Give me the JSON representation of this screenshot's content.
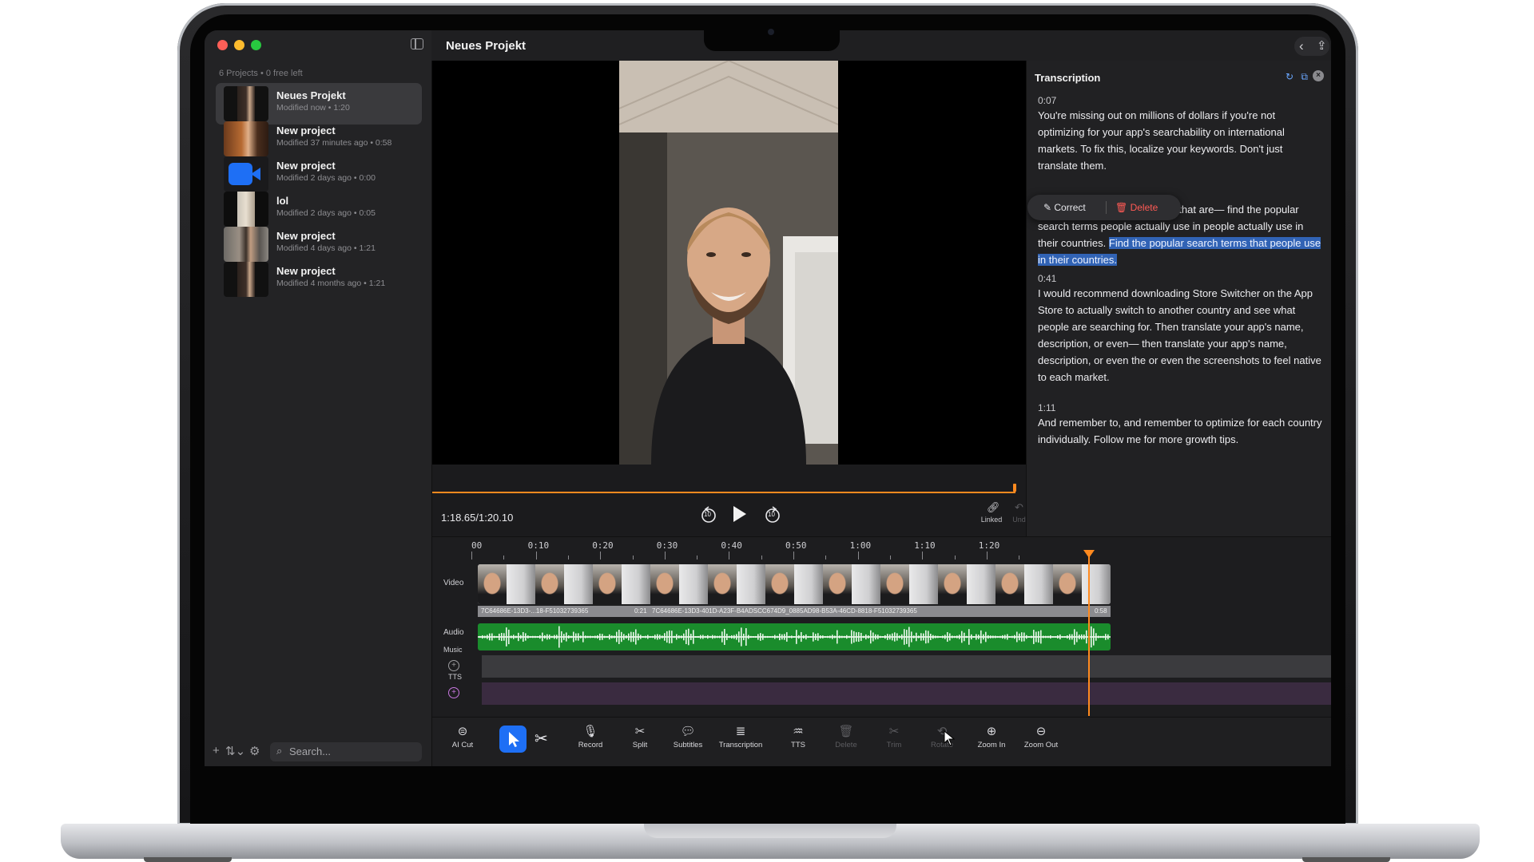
{
  "app": {
    "title": "Neues Projekt"
  },
  "sidebar": {
    "project_count": "6 Projects • 0 free left",
    "projects": [
      {
        "name": "Neues Projekt",
        "meta": "Modified now • 1:20",
        "selected": true
      },
      {
        "name": "New project",
        "meta": "Modified 37 minutes ago • 0:58"
      },
      {
        "name": "New project",
        "meta": "Modified 2 days ago • 0:00"
      },
      {
        "name": "lol",
        "meta": "Modified 2 days ago • 0:05"
      },
      {
        "name": "New project",
        "meta": "Modified 4 days ago • 1:21"
      },
      {
        "name": "New project",
        "meta": "Modified 4 months ago • 1:21"
      }
    ],
    "search_placeholder": "Search..."
  },
  "player": {
    "timecode": "1:18.65/1:20.10",
    "skip_back": "10",
    "skip_forward": "10",
    "linked_label": "Linked",
    "undo_label": "Undo",
    "progress": 0.98
  },
  "transcription": {
    "title": "Transcription",
    "segments": [
      {
        "time": "0:07",
        "text": "You're missing out on millions of dollars if you're not optimizing for your app's searchability on international markets. To fix this, localize your keywords. Don't just translate them."
      },
      {
        "time": "",
        "text_before": "Find the popular search terms that are— find the popular search terms people actually use in people actually use in their countries. ",
        "text_highlight": "Find the popular search terms that people use in their countries."
      },
      {
        "time": "0:41",
        "text": "I would recommend downloading Store Switcher on the App Store to actually switch to another country and see what people are searching for. Then translate your app's name, description, or even— then translate your app's name, description, or even the or even the screenshots to feel native to each market."
      },
      {
        "time": "1:11",
        "text": "And remember to, and remember to optimize for each country individually. Follow me for more growth tips."
      }
    ],
    "popup": {
      "correct": "Correct",
      "delete": "Delete"
    }
  },
  "timeline": {
    "ruler": [
      "00",
      "0:10",
      "0:20",
      "0:30",
      "0:40",
      "0:50",
      "1:00",
      "1:10",
      "1:20"
    ],
    "tracks": {
      "video": "Video",
      "audio": "Audio",
      "music": "Music",
      "tts": "TTS"
    },
    "clip1": "7C64686E-13D3-...18-F51032739365",
    "clip1_badge": "0:21",
    "clip2": "7C64686E-13D3-401D-A23F-B4ADSCC674D9_0885AD98-B53A-46CD-8818-F51032739365",
    "clip2_badge": "0:58",
    "playhead": 0.982
  },
  "toolbar": {
    "tools": [
      {
        "label": "AI Cut",
        "icon": "ai-cut-icon"
      },
      {
        "label": "Record",
        "icon": "microphone-icon"
      },
      {
        "label": "Split",
        "icon": "scissors-icon"
      },
      {
        "label": "Subtitles",
        "icon": "subtitles-icon"
      },
      {
        "label": "Transcription",
        "icon": "transcription-icon"
      },
      {
        "label": "TTS",
        "icon": "waveform-icon"
      },
      {
        "label": "Delete",
        "icon": "trash-icon",
        "disabled": true
      },
      {
        "label": "Trim",
        "icon": "trim-icon",
        "disabled": true
      },
      {
        "label": "Rotate",
        "icon": "rotate-icon",
        "disabled": true
      },
      {
        "label": "Zoom In",
        "icon": "zoom-in-icon"
      },
      {
        "label": "Zoom Out",
        "icon": "zoom-out-icon"
      }
    ]
  },
  "colors": {
    "accent": "#1e6ff5",
    "playhead": "#ff8a1f",
    "audio": "#1a8c2c",
    "highlight": "#3163b5"
  }
}
